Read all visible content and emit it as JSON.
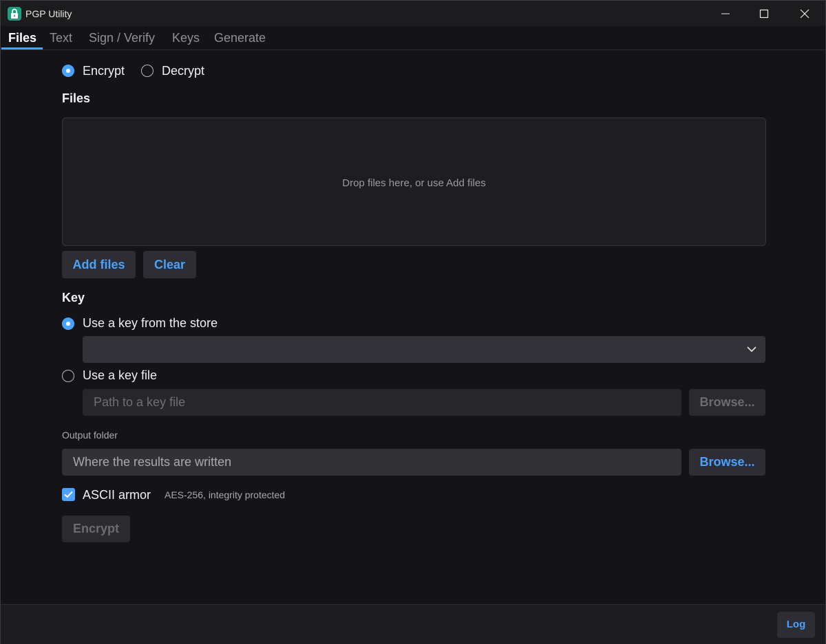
{
  "window": {
    "title": "PGP Utility"
  },
  "tabs": [
    {
      "label": "Files",
      "active": true
    },
    {
      "label": "Text",
      "active": false
    },
    {
      "label": "Sign / Verify",
      "active": false
    },
    {
      "label": "Keys",
      "active": false
    },
    {
      "label": "Generate",
      "active": false
    }
  ],
  "mode": {
    "encrypt_label": "Encrypt",
    "decrypt_label": "Decrypt",
    "selected": "Encrypt"
  },
  "files": {
    "title": "Files",
    "drop_hint": "Drop files here, or use Add files",
    "add_label": "Add files",
    "clear_label": "Clear"
  },
  "key": {
    "title": "Key",
    "store_option_label": "Use a key from the store",
    "store_selected_value": "",
    "file_option_label": "Use a key file",
    "file_path_placeholder": "Path to a key file",
    "file_browse_label": "Browse...",
    "selected": "store"
  },
  "output": {
    "label": "Output folder",
    "placeholder": "Where the results are written",
    "browse_label": "Browse..."
  },
  "options": {
    "ascii_armor_label": "ASCII armor",
    "ascii_armor_checked": true,
    "cipher_hint": "AES-256, integrity protected"
  },
  "actions": {
    "encrypt_label": "Encrypt"
  },
  "footer": {
    "log_label": "Log"
  },
  "colors": {
    "accent": "#4aa2ff",
    "background": "#141418",
    "app_icon": "#1a9e7e"
  }
}
